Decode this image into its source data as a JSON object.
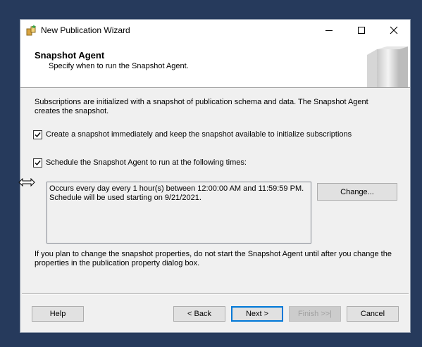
{
  "window": {
    "title": "New Publication Wizard"
  },
  "header": {
    "title": "Snapshot Agent",
    "subtitle": "Specify when to run the Snapshot Agent."
  },
  "intro": "Subscriptions are initialized with a snapshot of publication schema and data. The Snapshot Agent creates the snapshot.",
  "options": [
    {
      "label": "Create a snapshot immediately and keep the snapshot available to initialize subscriptions",
      "checked": true
    },
    {
      "label": "Schedule the Snapshot Agent to run at the following times:",
      "checked": true
    }
  ],
  "schedule": {
    "line1": "Occurs every day every 1 hour(s) between 12:00:00 AM and 11:59:59 PM.",
    "line2": "Schedule will be used starting on 9/21/2021.",
    "change_label": "Change..."
  },
  "note": "If you plan to change the snapshot properties, do not start the Snapshot Agent until after you change the properties in the publication property dialog box.",
  "footer": {
    "help_label": "Help",
    "back_label": "< Back",
    "next_label": "Next >",
    "finish_label": "Finish >>|",
    "cancel_label": "Cancel"
  },
  "colors": {
    "desktop": "#263a5c",
    "dialog": "#f0f0f0",
    "default_button_border": "#0078d7"
  },
  "icons": [
    "wizard-app-icon",
    "minimize-icon",
    "maximize-icon",
    "close-icon",
    "checkmark-icon",
    "resize-cursor-icon"
  ]
}
